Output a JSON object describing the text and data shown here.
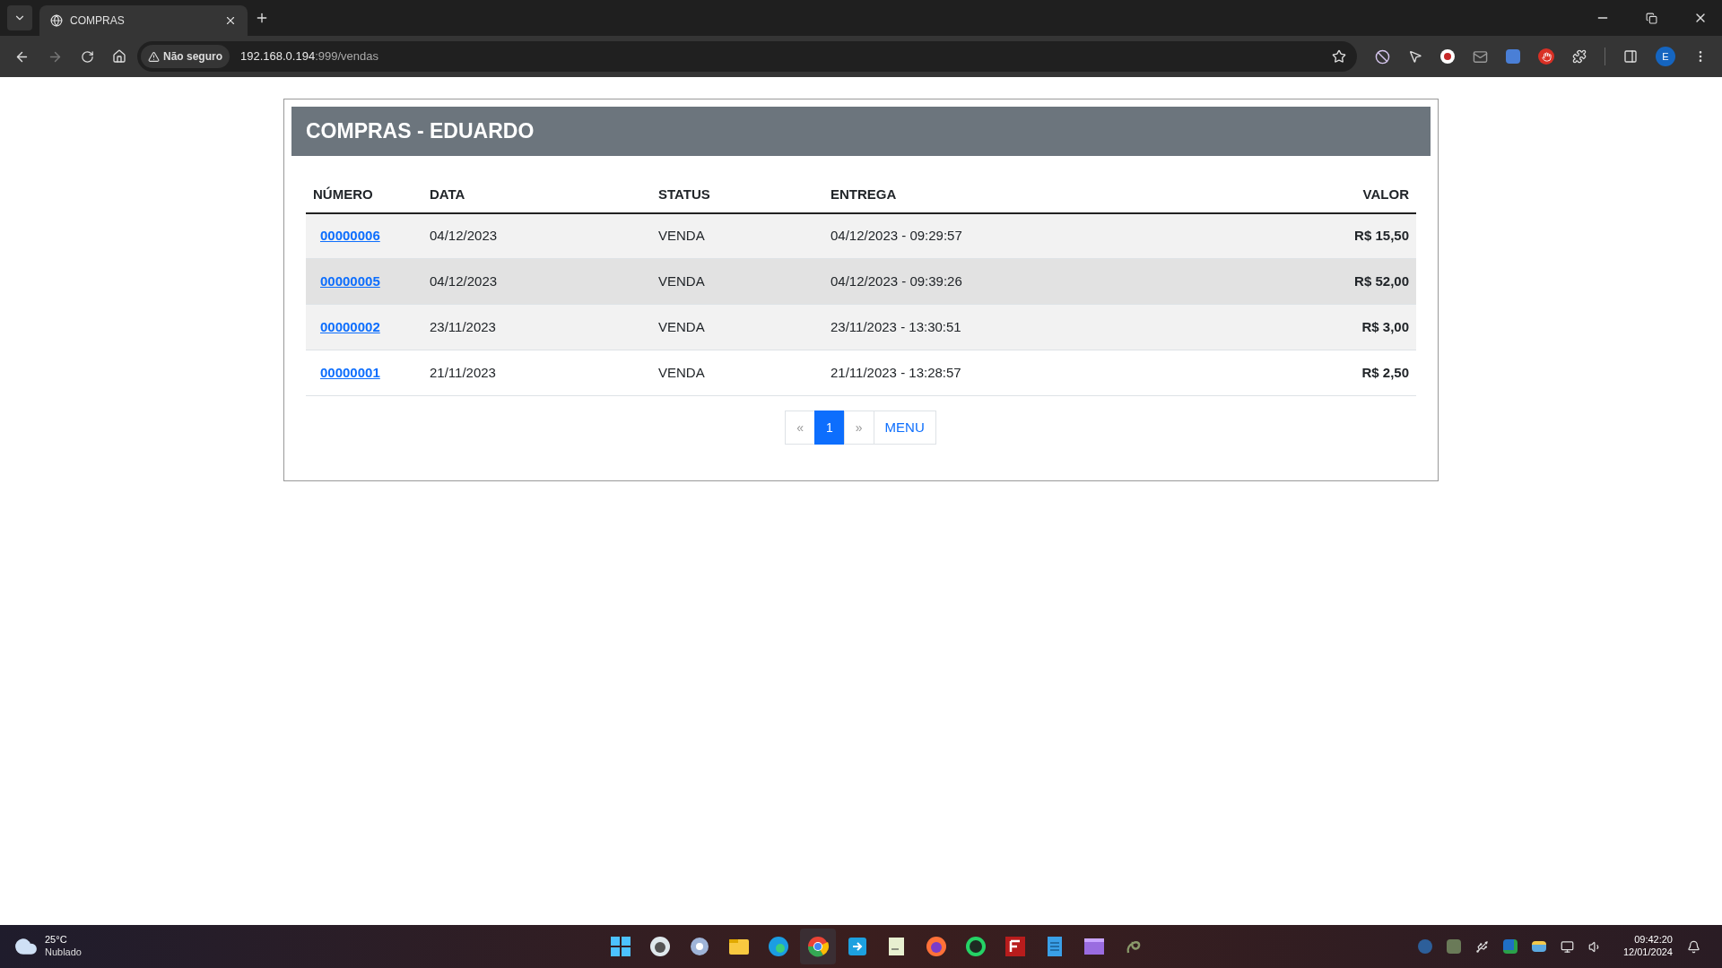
{
  "browser": {
    "tab_title": "COMPRAS",
    "security_label": "Não seguro",
    "url_host": "192.168.0.194",
    "url_rest": ":999/vendas",
    "profile_initial": "E"
  },
  "card": {
    "title": "COMPRAS - EDUARDO"
  },
  "table": {
    "columns": [
      "NÚMERO",
      "DATA",
      "STATUS",
      "ENTREGA",
      "VALOR"
    ],
    "rows": [
      {
        "number": "00000006",
        "date": "04/12/2023",
        "status": "VENDA",
        "delivery": "04/12/2023 - 09:29:57",
        "value": "R$ 15,50",
        "hovered": false
      },
      {
        "number": "00000005",
        "date": "04/12/2023",
        "status": "VENDA",
        "delivery": "04/12/2023 - 09:39:26",
        "value": "R$ 52,00",
        "hovered": true
      },
      {
        "number": "00000002",
        "date": "23/11/2023",
        "status": "VENDA",
        "delivery": "23/11/2023 - 13:30:51",
        "value": "R$ 3,00",
        "hovered": false
      },
      {
        "number": "00000001",
        "date": "21/11/2023",
        "status": "VENDA",
        "delivery": "21/11/2023 - 13:28:57",
        "value": "R$ 2,50",
        "hovered": false
      }
    ]
  },
  "pagination": [
    {
      "label": "«",
      "kind": "page",
      "selected": false,
      "disabled": true
    },
    {
      "label": "1",
      "kind": "page",
      "selected": true,
      "disabled": false
    },
    {
      "label": "»",
      "kind": "page",
      "selected": false,
      "disabled": true
    },
    {
      "label": "MENU",
      "kind": "link",
      "selected": false,
      "disabled": false
    }
  ],
  "taskbar": {
    "weather_temp": "25°C",
    "weather_text": "Nublado",
    "time": "09:42:20",
    "date": "12/01/2024"
  }
}
